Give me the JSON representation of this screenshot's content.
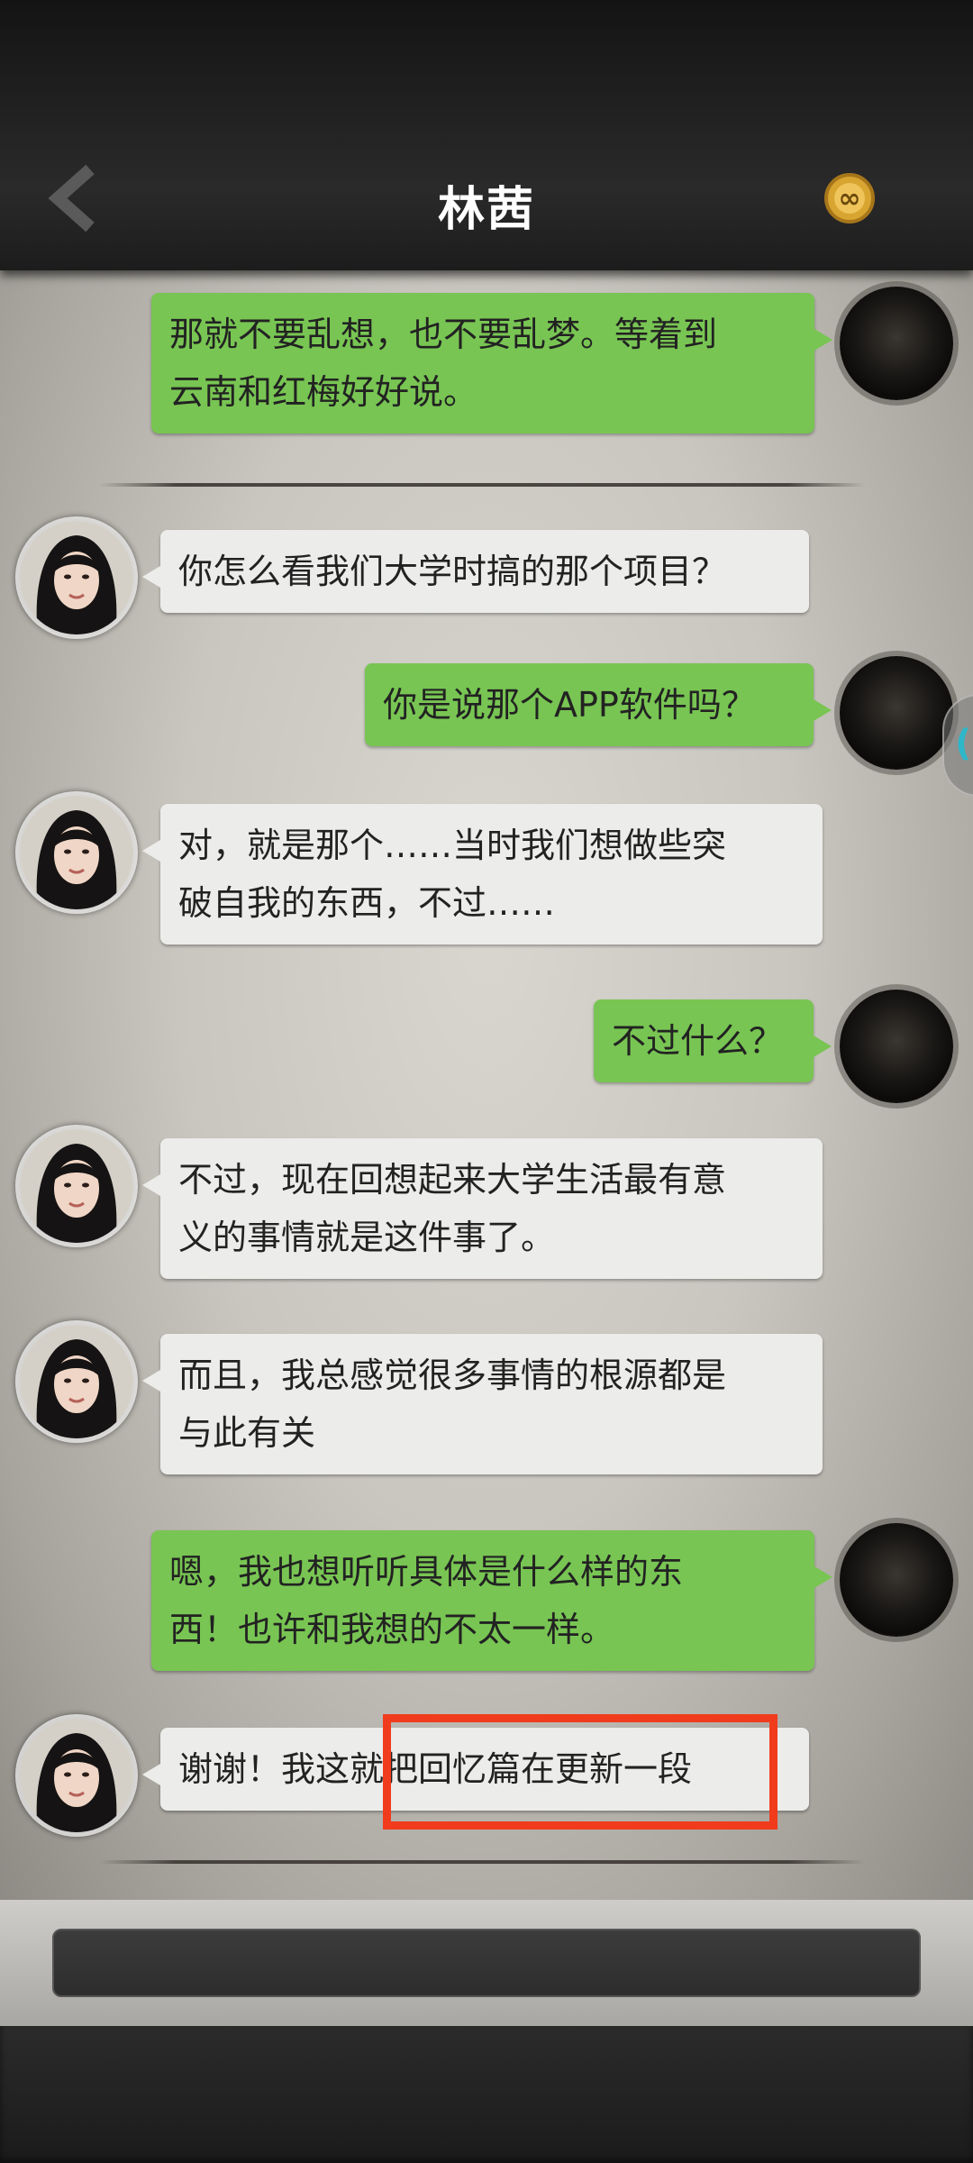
{
  "header": {
    "title": "林茜",
    "back_icon": "chevron-left-icon",
    "badge_icon": "infinity-coin-icon",
    "badge_symbol": "∞"
  },
  "messages": [
    {
      "side": "right",
      "text_lines": [
        "那就不要乱想，也不要乱梦。等着到",
        "云南和红梅好好说。"
      ]
    },
    {
      "side": "left",
      "text_lines": [
        "你怎么看我们大学时搞的那个项目？"
      ]
    },
    {
      "side": "right",
      "text_lines": [
        "你是说那个APP软件吗？"
      ]
    },
    {
      "side": "left",
      "text_lines": [
        "对，就是那个……当时我们想做些突",
        "破自我的东西，不过……"
      ]
    },
    {
      "side": "right",
      "text_lines": [
        "不过什么？"
      ]
    },
    {
      "side": "left",
      "text_lines": [
        "不过，现在回想起来大学生活最有意",
        "义的事情就是这件事了。"
      ]
    },
    {
      "side": "left",
      "text_lines": [
        "而且，我总感觉很多事情的根源都是",
        "与此有关"
      ]
    },
    {
      "side": "right",
      "text_lines": [
        "嗯，我也想听听具体是什么样的东",
        "西！也许和我想的不太一样。"
      ]
    },
    {
      "side": "left",
      "text_lines": [
        "谢谢！我这就把回忆篇在更新一段"
      ]
    }
  ],
  "side_handle": {
    "label": "("
  },
  "input": {
    "placeholder": ""
  },
  "colors": {
    "my_bubble": "#78c553",
    "her_bubble": "#ececea",
    "highlight": "#f13b1d"
  }
}
